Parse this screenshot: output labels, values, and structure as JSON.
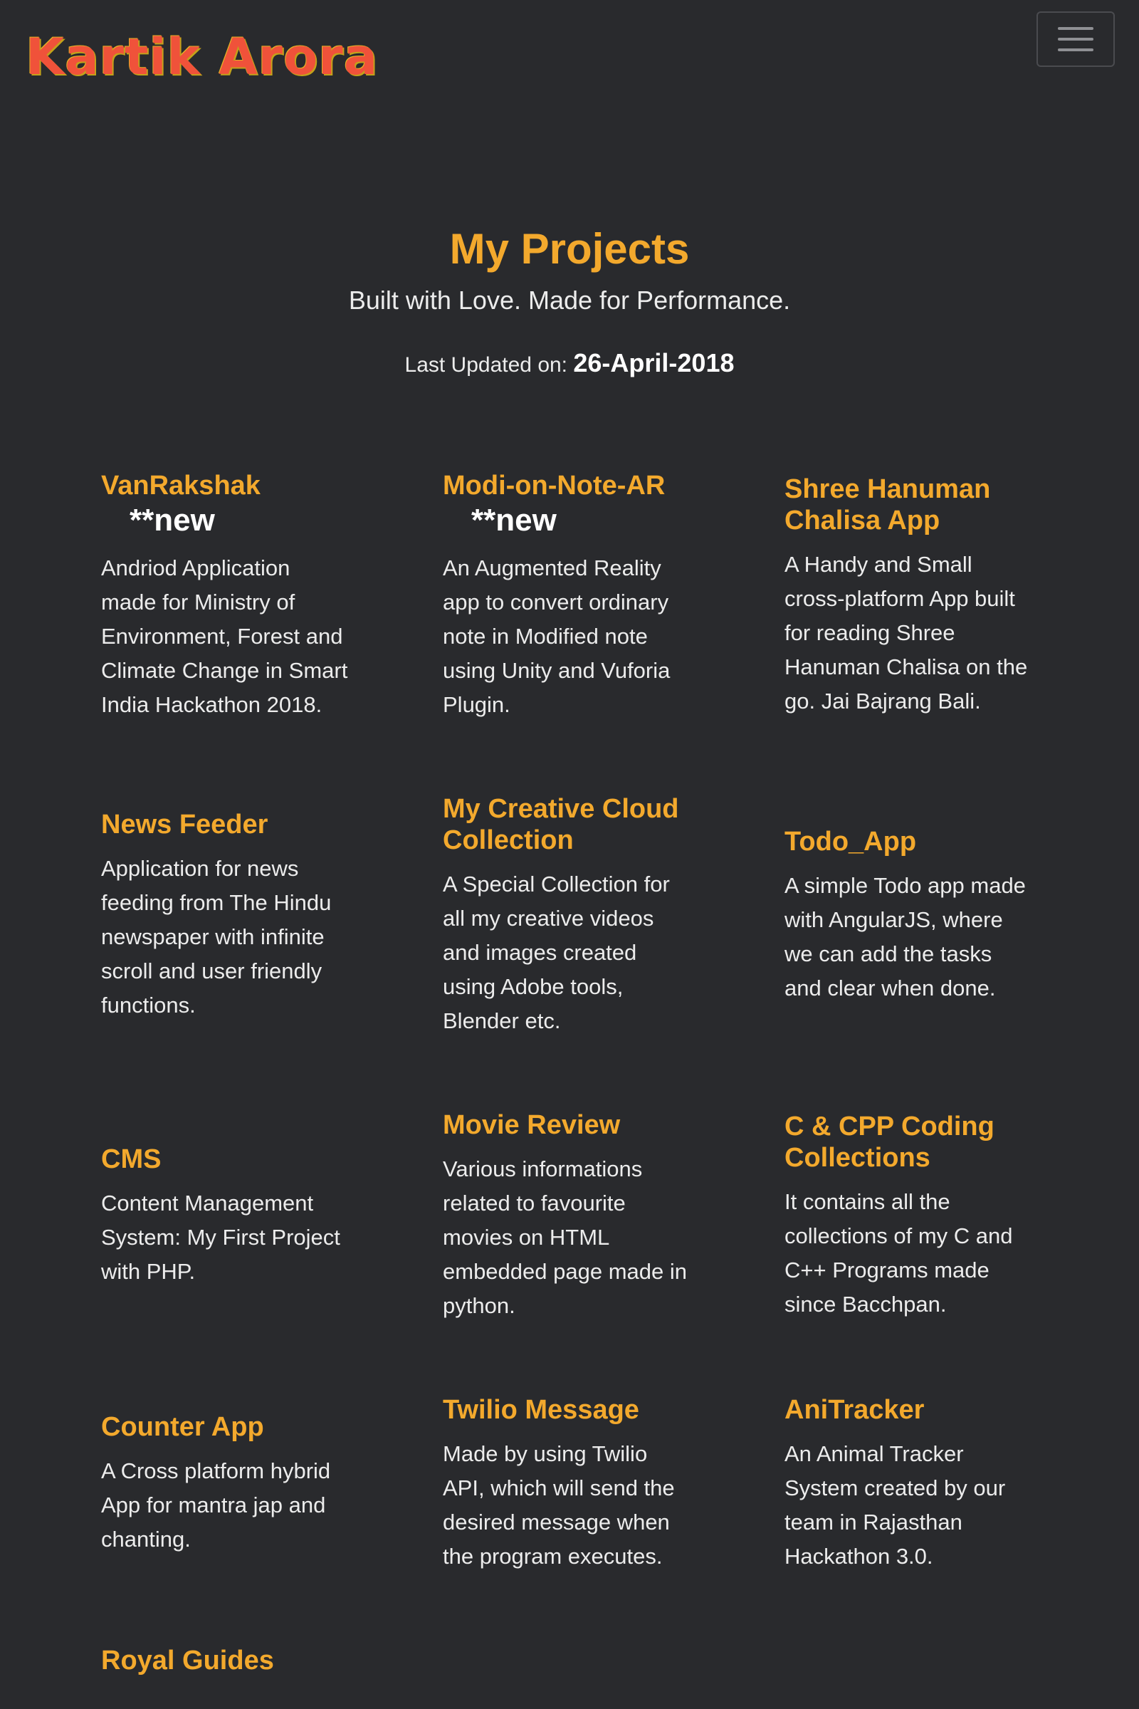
{
  "navbar": {
    "brand": "Kartik Arora",
    "toggler_icon": "hamburger-icon"
  },
  "header": {
    "title": "My Projects",
    "subtitle": "Built with Love. Made for Performance.",
    "updated_label": "Last Updated on:",
    "updated_date": "26-April-2018"
  },
  "projects": [
    {
      "title": "VanRakshak",
      "badge": "**new",
      "desc": "Andriod Application made for Ministry of Environment, Forest and Climate Change in Smart India Hackathon 2018."
    },
    {
      "title": "Modi-on-Note-AR",
      "badge": "**new",
      "desc": "An Augmented Reality app to convert ordinary note in Modified note using Unity and Vuforia Plugin."
    },
    {
      "title": "Shree Hanuman Chalisa App",
      "desc": "A Handy and Small cross-platform App built for reading Shree Hanuman Chalisa on the go. Jai Bajrang Bali."
    },
    {
      "title": "News Feeder",
      "desc": "Application for news feeding from The Hindu newspaper with infinite scroll and user friendly functions."
    },
    {
      "title": "My Creative Cloud Collection",
      "desc": "A Special Collection for all my creative videos and images created using Adobe tools, Blender etc."
    },
    {
      "title": "Todo_App",
      "desc": "A simple Todo app made with AngularJS, where we can add the tasks and clear when done."
    },
    {
      "title": "CMS",
      "desc": "Content Management System: My First Project with PHP."
    },
    {
      "title": "Movie Review",
      "desc": "Various informations related to favourite movies on HTML embedded page made in python."
    },
    {
      "title": "C & CPP Coding Collections",
      "desc": "It contains all the collections of my C and C++ Programs made since Bacchpan."
    },
    {
      "title": "Counter App",
      "desc": "A Cross platform hybrid App for mantra jap and chanting."
    },
    {
      "title": "Twilio Message",
      "desc": "Made by using Twilio API, which will send the desired message when the program executes."
    },
    {
      "title": "AniTracker",
      "desc": "An Animal Tracker System created by our team in Rajasthan Hackathon 3.0."
    },
    {
      "title": "Royal Guides"
    }
  ],
  "colors": {
    "background": "#292a2d",
    "accent": "#f3a92d",
    "brand": "#f0523a",
    "text": "#ececec"
  }
}
